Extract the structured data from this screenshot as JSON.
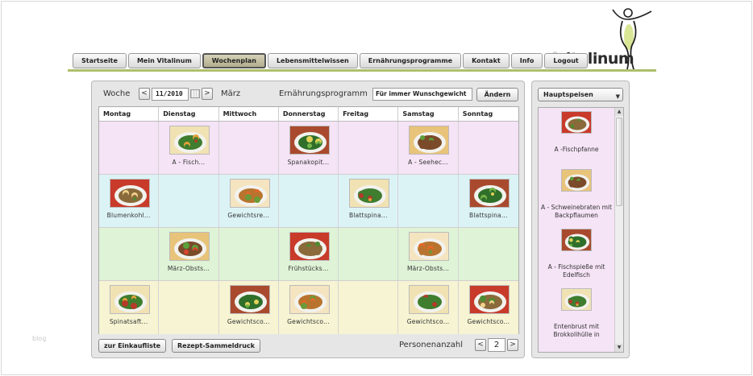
{
  "nav": {
    "items": [
      "Startseite",
      "Mein Vitalinum",
      "Wochenplan",
      "Lebensmittelwissen",
      "Ernährungsprogramme",
      "Kontakt",
      "Info",
      "Logout"
    ],
    "active_index": 2
  },
  "logo": {
    "registered": "®",
    "text": "vitalinum"
  },
  "planner": {
    "week_label": "Woche",
    "prev_symbol": "<",
    "next_symbol": ">",
    "week_value": "11/2010",
    "month": "März",
    "program_label": "Ernährungsprogramm",
    "program_value": "Für immer Wunschgewicht",
    "change_label": "Ändern",
    "days": [
      "Montag",
      "Dienstag",
      "Mittwoch",
      "Donnerstag",
      "Freitag",
      "Samstag",
      "Sonntag"
    ],
    "rows": [
      [
        "",
        "A - Fisch...",
        "",
        "Spanakopit...",
        "",
        "A - Seehec...",
        ""
      ],
      [
        "Blumenkohl...",
        "",
        "Gewichtsre...",
        "",
        "Blattspina...",
        "",
        "Blattspina..."
      ],
      [
        "",
        "März-Obsts...",
        "",
        "Frühstücks...",
        "",
        "März-Obsts...",
        ""
      ],
      [
        "Spinatsaft...",
        "",
        "Gewichtsco...",
        "Gewichtsco...",
        "",
        "Gewichtsco...",
        "Gewichtsco..."
      ]
    ],
    "shopping_list_label": "zur Einkaufliste",
    "recipe_print_label": "Rezept-Sammeldruck",
    "persons_label": "Personenanzahl",
    "persons_value": "2"
  },
  "side": {
    "category": "Hauptspeisen",
    "dropdown_symbol": "▼",
    "scroll_up_symbol": "▲",
    "scroll_down_symbol": "▼",
    "items": [
      "A -Fischpfanne",
      "A - Schweinebraten mit Backpflaumen",
      "A - Fischspieße mit Edelfisch",
      "Entenbrust mit Brokkolihülle in"
    ]
  },
  "footer": {
    "blog": "blog"
  },
  "colors": {
    "accent_line": "#aebf6a",
    "row_colors": [
      "#f5e3f6",
      "#dcf3f6",
      "#dff3d6",
      "#f6f4d2"
    ],
    "logo_green": "#c7dc6a"
  }
}
